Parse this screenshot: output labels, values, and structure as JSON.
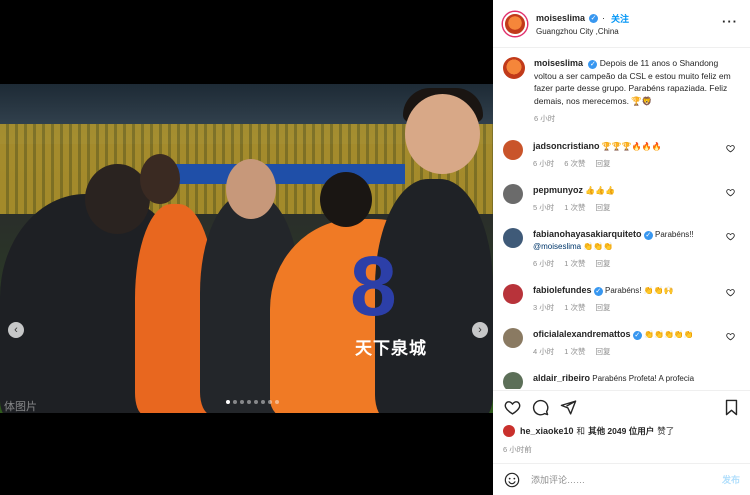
{
  "post": {
    "username": "moiseslima",
    "follow_label": "关注",
    "location": "Guangzhou City ,China",
    "more_label": "···"
  },
  "photo": {
    "jersey_number": "8",
    "jersey_text": "天下泉城",
    "watermark": "体图片"
  },
  "caption": {
    "username": "moiseslima",
    "text": "Depois de 11 anos o Shandong voltou a ser campeão da CSL e estou muito feliz em fazer parte desse grupo. Parabéns rapaziada. Feliz demais, nos merecemos. 🏆🦁",
    "time": "6 小时"
  },
  "comments": [
    {
      "username": "jadsoncristiano",
      "text": "🏆🏆🏆🔥🔥🔥",
      "time": "6 小时",
      "likes": "6 次赞",
      "reply": "回复",
      "avatar_color": "#c9542a"
    },
    {
      "username": "pepmunyoz",
      "text": "👍👍👍",
      "time": "5 小时",
      "likes": "1 次赞",
      "reply": "回复",
      "avatar_color": "#6b6b6b"
    },
    {
      "username": "fabianohayasakiarquiteto",
      "text": "Parabéns!!",
      "mention": "@moiseslima",
      "mention_tail": " 👏👏👏",
      "time": "6 小时",
      "likes": "1 次赞",
      "reply": "回复",
      "avatar_color": "#3f5a78"
    },
    {
      "username": "fabiolefundes",
      "text": "Parabéns! 👏👏🙌",
      "time": "3 小时",
      "likes": "1 次赞",
      "reply": "回复",
      "avatar_color": "#b8333a"
    },
    {
      "username": "oficialalexandremattos",
      "text": "👏👏👏👏👏",
      "time": "4 小时",
      "likes": "1 次赞",
      "reply": "回复",
      "avatar_color": "#8a7a62"
    },
    {
      "username": "aldair_ribeiro",
      "text": "Parabéns Profeta! A profecia",
      "time": "",
      "likes": "",
      "reply": "",
      "avatar_color": "#5c6f58"
    }
  ],
  "likes": {
    "username": "he_xiaoke10",
    "connector": "和",
    "others": "其他 2049 位用户",
    "suffix": "赞了"
  },
  "post_time": "6 小时前",
  "add_comment": {
    "placeholder": "添加评论……",
    "post_label": "发布"
  },
  "colors": {
    "accent": "#0095f6",
    "verified": "#3897f0",
    "jersey_orange": "#f07a25"
  }
}
